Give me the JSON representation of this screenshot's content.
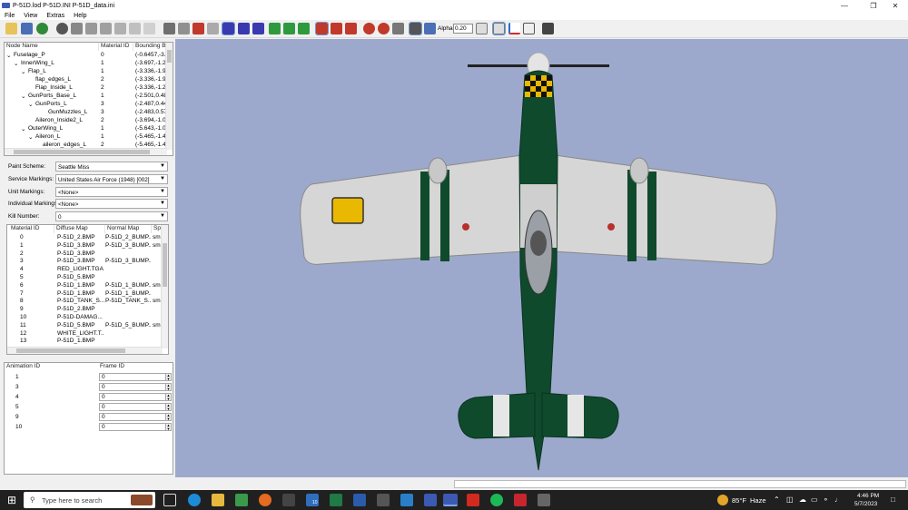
{
  "window": {
    "title": "P-51D.lod  P-51D.INI  P-51D_data.ini"
  },
  "menu": [
    "File",
    "View",
    "Extras",
    "Help"
  ],
  "toolbar": {
    "alpha_label": "Alpha:",
    "alpha_value": "0.20"
  },
  "node_table": {
    "headers": [
      "Node Name",
      "Material ID",
      "Bounding B"
    ],
    "rows": [
      {
        "expander": "⌄",
        "name": "Fuselage_P",
        "mat": "0",
        "bb": "(-0.6457,-3.8"
      },
      {
        "expander": "⌄",
        "name": "InnerWing_L",
        "mat": "1",
        "bb": "(-3.697,-1.29"
      },
      {
        "expander": "⌄",
        "name": "Flap_L",
        "mat": "1",
        "bb": "(-3.336,-1.96"
      },
      {
        "expander": "",
        "name": "flap_edges_L",
        "mat": "2",
        "bb": "(-3.336,-1.96"
      },
      {
        "expander": "",
        "name": "Flap_Inside_L",
        "mat": "2",
        "bb": "(-3.336,-1.29"
      },
      {
        "expander": "⌄",
        "name": "GunPorts_Base_L",
        "mat": "1",
        "bb": "(-2.501,0.480"
      },
      {
        "expander": "⌄",
        "name": "GunPorts_L",
        "mat": "3",
        "bb": "(-2.487,0.446"
      },
      {
        "expander": "",
        "name": "GunMuzzles_L",
        "mat": "3",
        "bb": "(-2.483,0.579"
      },
      {
        "expander": "",
        "name": "Aileron_Inside2_L",
        "mat": "2",
        "bb": "(-3.694,-1.03"
      },
      {
        "expander": "⌄",
        "name": "OuterWing_L",
        "mat": "1",
        "bb": "(-5.643,-1.02"
      },
      {
        "expander": "⌄",
        "name": "Aileron_L",
        "mat": "1",
        "bb": "(-5.465,-1.43"
      },
      {
        "expander": "",
        "name": "aileron_edges_L",
        "mat": "2",
        "bb": "(-5.465,-1.43"
      }
    ]
  },
  "fields": {
    "paint_scheme": {
      "label": "Paint Scheme:",
      "value": "Seattle Miss"
    },
    "service_markings": {
      "label": "Service Markings:",
      "value": "United States Air Force (1948) [002]"
    },
    "unit_markings": {
      "label": "Unit Markings:",
      "value": "<None>"
    },
    "individual_markings": {
      "label": "Individual Markings:",
      "value": "<None>"
    },
    "kill_number": {
      "label": "Kill Number:",
      "value": "0"
    }
  },
  "material_table": {
    "headers": [
      "Material ID",
      "Diffuse Map",
      "Normal Map",
      "Spe"
    ],
    "rows": [
      {
        "id": "0",
        "diffuse": "P-51D_2.BMP",
        "normal": "P-51D_2_BUMP....",
        "spec": "sm"
      },
      {
        "id": "1",
        "diffuse": "P-51D_3.BMP",
        "normal": "P-51D_3_BUMP....",
        "spec": "sm"
      },
      {
        "id": "2",
        "diffuse": "P-51D_3.BMP",
        "normal": "",
        "spec": ""
      },
      {
        "id": "3",
        "diffuse": "P-51D_3.BMP",
        "normal": "P-51D_3_BUMP....",
        "spec": ""
      },
      {
        "id": "4",
        "diffuse": "RED_LIGHT.TGA",
        "normal": "",
        "spec": ""
      },
      {
        "id": "5",
        "diffuse": "P-51D_5.BMP",
        "normal": "",
        "spec": ""
      },
      {
        "id": "6",
        "diffuse": "P-51D_1.BMP",
        "normal": "P-51D_1_BUMP....",
        "spec": "sm"
      },
      {
        "id": "7",
        "diffuse": "P-51D_1.BMP",
        "normal": "P-51D_1_BUMP....",
        "spec": ""
      },
      {
        "id": "8",
        "diffuse": "P-51D_TANK_S...",
        "normal": "P-51D_TANK_S...",
        "spec": "sm"
      },
      {
        "id": "9",
        "diffuse": "P-51D_2.BMP",
        "normal": "",
        "spec": ""
      },
      {
        "id": "10",
        "diffuse": "P-51D-DAMAG...",
        "normal": "",
        "spec": ""
      },
      {
        "id": "11",
        "diffuse": "P-51D_5.BMP",
        "normal": "P-51D_5_BUMP....",
        "spec": "sm"
      },
      {
        "id": "12",
        "diffuse": "WHITE_LIGHT.T...",
        "normal": "",
        "spec": ""
      },
      {
        "id": "13",
        "diffuse": "P-51D_1.BMP",
        "normal": "",
        "spec": ""
      }
    ]
  },
  "animation_table": {
    "headers": [
      "Animation ID",
      "Frame ID"
    ],
    "rows": [
      {
        "id": "1",
        "frame": "0"
      },
      {
        "id": "3",
        "frame": "0"
      },
      {
        "id": "4",
        "frame": "0"
      },
      {
        "id": "5",
        "frame": "0"
      },
      {
        "id": "9",
        "frame": "0"
      },
      {
        "id": "10",
        "frame": "0"
      }
    ]
  },
  "taskbar": {
    "search_placeholder": "Type here to search",
    "weather_temp": "85°F",
    "weather_desc": "Haze",
    "time": "4:46 PM",
    "date": "5/7/2023",
    "mail_badge": "10"
  },
  "colors": {
    "viewport_bg": "#9da9cc",
    "aircraft_green": "#0f4a2c",
    "aircraft_silver": "#d6d6d6",
    "marking_yellow": "#e9b800"
  }
}
